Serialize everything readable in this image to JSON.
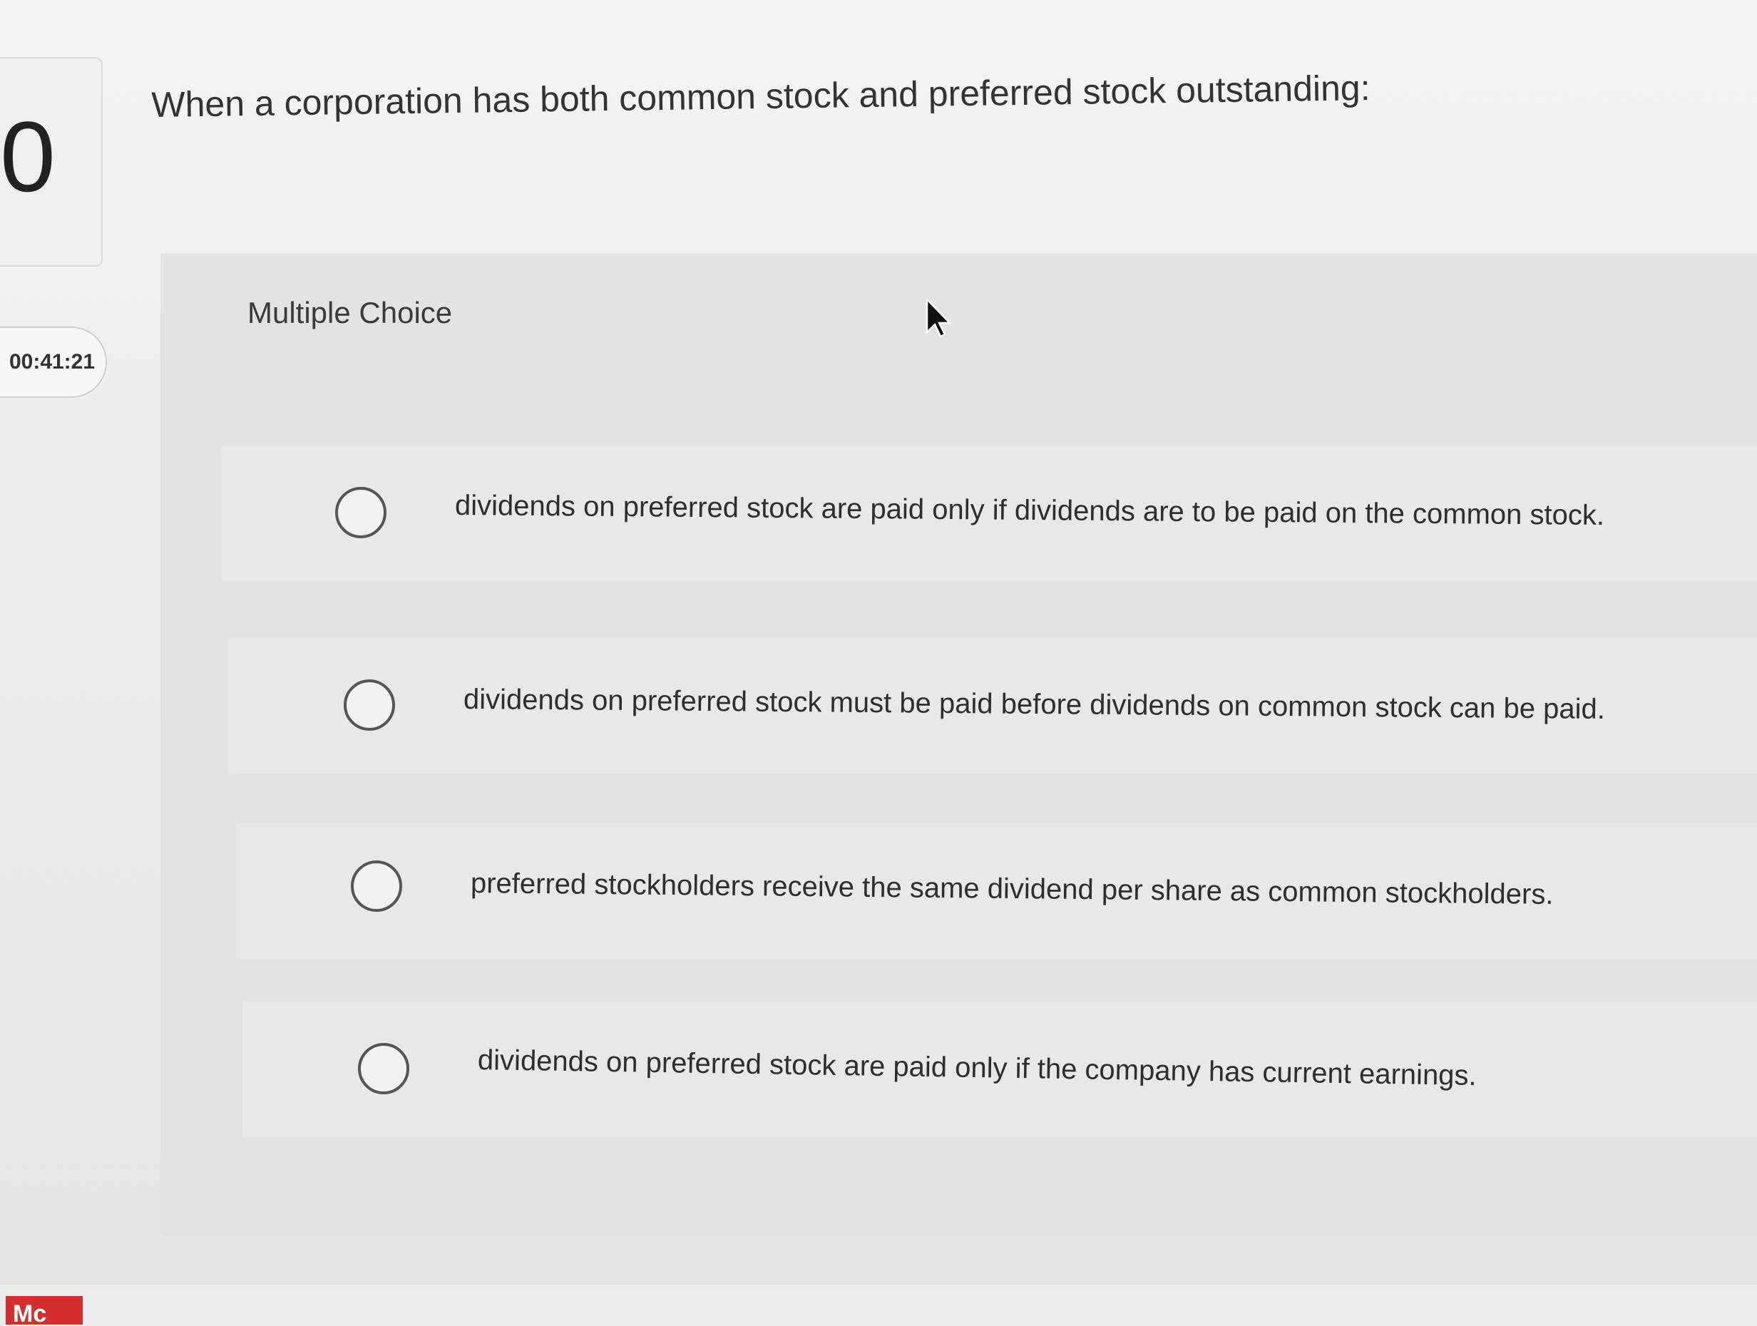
{
  "question": {
    "number": "0",
    "timer": "00:41:21",
    "text": "When a corporation has both common stock and preferred stock outstanding:"
  },
  "answers": {
    "type_label": "Multiple Choice",
    "options": [
      {
        "label": "dividends on preferred stock are paid only if dividends are to be paid on the common stock.",
        "selected": false
      },
      {
        "label": "dividends on preferred stock must be paid before dividends on common stock can be paid.",
        "selected": false
      },
      {
        "label": "preferred stockholders receive the same dividend per share as common stockholders.",
        "selected": false
      },
      {
        "label": "dividends on preferred stock are paid only if the company has current earnings.",
        "selected": false
      }
    ]
  },
  "footer": {
    "logo_text": "Mc"
  },
  "icons": {
    "cursor": "mouse-pointer-icon"
  },
  "colors": {
    "logo_red": "#d32f2f",
    "radio_border": "#555555"
  }
}
